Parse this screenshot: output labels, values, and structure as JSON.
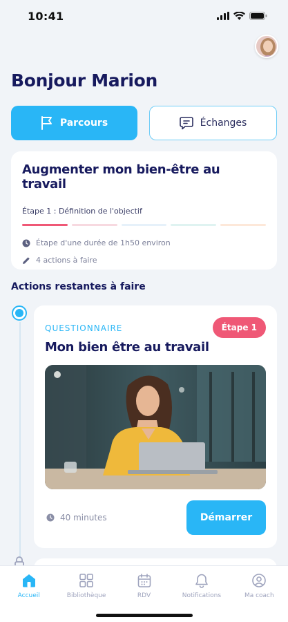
{
  "status_bar": {
    "time": "10:41"
  },
  "header": {
    "greeting": "Bonjour Marion"
  },
  "tabs": [
    {
      "label": "Parcours",
      "icon": "flag-icon",
      "active": true
    },
    {
      "label": "Échanges",
      "icon": "chat-icon",
      "active": false
    }
  ],
  "program": {
    "title": "Augmenter mon bien-être au travail",
    "step_label": "Étape 1 : Définition de l'objectif",
    "progress_colors": [
      "#ef5876",
      "#f7d9e0",
      "#e6f1fa",
      "#dff3f1",
      "#fde8d9"
    ],
    "duration": "Étape d'une durée de 1h50 environ",
    "actions": "4 actions à faire"
  },
  "section": {
    "title": "Actions restantes à faire"
  },
  "action_card": {
    "type": "QUESTIONNAIRE",
    "badge": "Étape 1",
    "title": "Mon bien être au travail",
    "duration": "40 minutes",
    "button": "Démarrer"
  },
  "bottom_nav": [
    {
      "label": "Accueil",
      "icon": "home-icon",
      "active": true
    },
    {
      "label": "Bibliothèque",
      "icon": "grid-icon",
      "active": false
    },
    {
      "label": "RDV",
      "icon": "calendar-icon",
      "active": false
    },
    {
      "label": "Notifications",
      "icon": "bell-icon",
      "active": false
    },
    {
      "label": "Ma coach",
      "icon": "user-icon",
      "active": false
    }
  ],
  "colors": {
    "accent": "#29b6f6",
    "badge": "#ef5876",
    "title": "#171a5e"
  }
}
